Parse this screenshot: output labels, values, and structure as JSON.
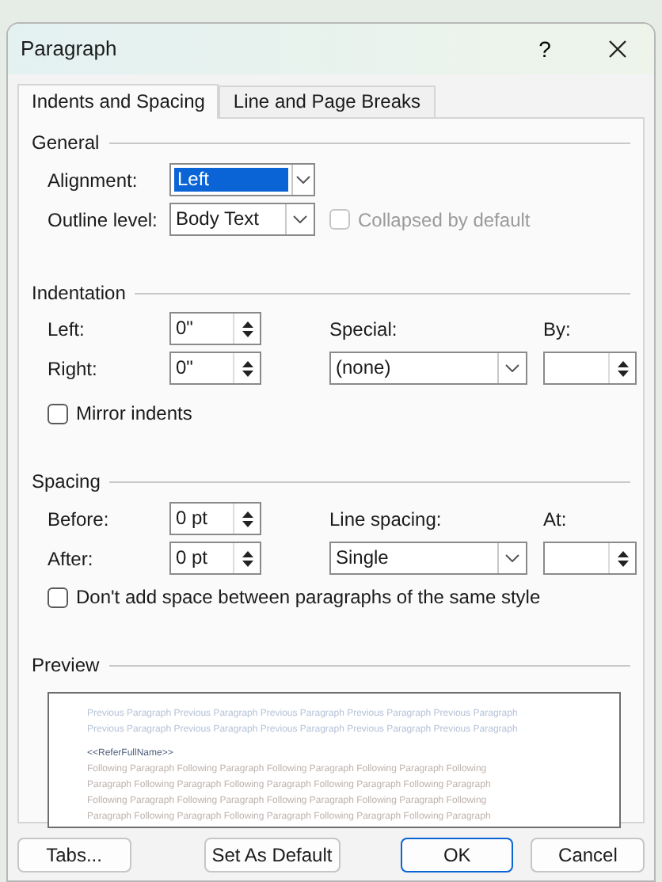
{
  "window": {
    "title": "Paragraph",
    "help": "?"
  },
  "tabs": [
    {
      "label": "Indents and Spacing",
      "selected": true
    },
    {
      "label": "Line and Page Breaks",
      "selected": false
    }
  ],
  "general": {
    "legend": "General",
    "alignment": {
      "label": "Alignment:",
      "value": "Left",
      "highlighted": true
    },
    "outline_level": {
      "label": "Outline level:",
      "value": "Body Text",
      "highlighted": false
    },
    "collapsed": {
      "label": "Collapsed by default",
      "checked": false,
      "disabled": true
    }
  },
  "indentation": {
    "legend": "Indentation",
    "left": {
      "label": "Left:",
      "value": "0\""
    },
    "right": {
      "label": "Right:",
      "value": "0\""
    },
    "special": {
      "label": "Special:",
      "value": "(none)"
    },
    "by": {
      "label": "By:"
    },
    "mirror": {
      "label": "Mirror indents",
      "checked": false,
      "disabled": false
    }
  },
  "spacing": {
    "legend": "Spacing",
    "before": {
      "label": "Before:",
      "value": "0 pt"
    },
    "after": {
      "label": "After:",
      "value": "0 pt"
    },
    "line_spacing": {
      "label": "Line spacing:",
      "value": "Single"
    },
    "at": {
      "label": "At:"
    },
    "no_space": {
      "label": "Don't add space between paragraphs of the same style",
      "checked": false,
      "disabled": false
    }
  },
  "preview": {
    "legend": "Preview",
    "previous_lines": [
      "Previous Paragraph Previous Paragraph Previous Paragraph Previous Paragraph Previous Paragraph",
      "Previous Paragraph Previous Paragraph Previous Paragraph Previous Paragraph Previous Paragraph"
    ],
    "current": "<<ReferFullName>>",
    "following_lines": [
      "Following Paragraph Following Paragraph Following Paragraph Following Paragraph Following",
      "Paragraph Following Paragraph Following Paragraph Following Paragraph Following Paragraph",
      "Following Paragraph Following Paragraph Following Paragraph Following Paragraph Following",
      "Paragraph Following Paragraph Following Paragraph Following Paragraph Following Paragraph"
    ]
  },
  "buttons": [
    {
      "label": "Tabs...",
      "default": false
    },
    {
      "label": "Set As Default",
      "default": false
    },
    {
      "label": "OK",
      "default": true
    },
    {
      "label": "Cancel",
      "default": false
    }
  ]
}
